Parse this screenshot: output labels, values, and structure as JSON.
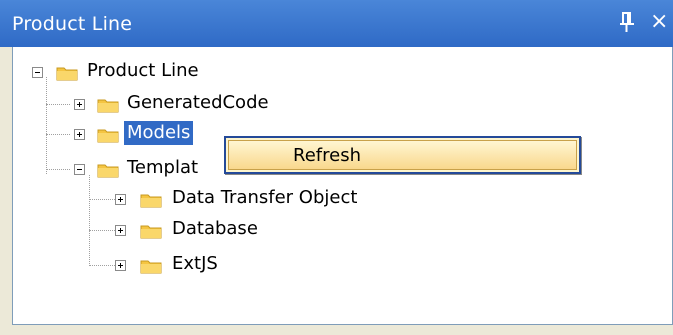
{
  "window": {
    "title": "Product Line",
    "pin_icon": "pin-icon",
    "close_label": "×"
  },
  "tree": {
    "root": {
      "label": "Product Line",
      "expanded": true
    },
    "children": [
      {
        "label": "GeneratedCode",
        "expanded": false
      },
      {
        "label": "Models",
        "expanded": false,
        "selected": true
      },
      {
        "label": "Templat",
        "expanded": true,
        "children": [
          {
            "label": "Data Transfer Object",
            "expanded": false
          },
          {
            "label": "Database",
            "expanded": false
          },
          {
            "label": "ExtJS",
            "expanded": false
          }
        ]
      }
    ]
  },
  "context_menu": {
    "items": [
      {
        "label": "Refresh"
      }
    ]
  },
  "colors": {
    "titlebar": "#2f6ac6",
    "selection": "#316ac5",
    "menu_bg": "#fdf5ce",
    "menu_border": "#244a99",
    "folder": "#f5c542"
  }
}
